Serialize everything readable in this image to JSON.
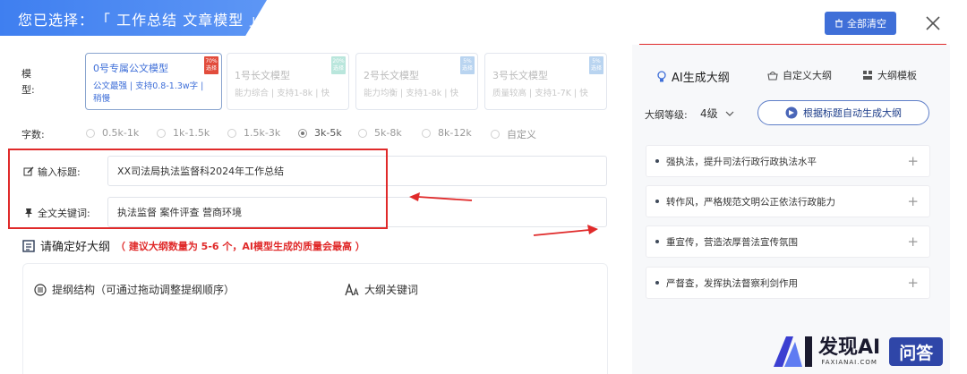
{
  "header": {
    "prefix": "您已选择：",
    "selection": "「 工作总结 文章模型 」"
  },
  "toolbar": {
    "clear_label": "全部清空"
  },
  "form": {
    "model_label": "模\n型:",
    "models": [
      {
        "name": "0号专属公文模型",
        "desc": "公文最强 | 支持0.8-1.3w字 | 稍慢",
        "badge": "70%\n选择",
        "badge_color": "#e24c3c"
      },
      {
        "name": "1号长文模型",
        "desc": "能力综合 | 支持1-8k | 快",
        "badge": "20%\n选择",
        "badge_color": "#b9e6dc"
      },
      {
        "name": "2号长文模型",
        "desc": "能力均衡 | 支持1-8k | 快",
        "badge": "5%\n选择",
        "badge_color": "#b9d4f0"
      },
      {
        "name": "3号长文模型",
        "desc": "质量较高 | 支持1-7K | 快",
        "badge": "5%\n选择",
        "badge_color": "#b9d4f0"
      }
    ],
    "wordcount_label": "字数:",
    "wordcounts": [
      "0.5k-1k",
      "1k-1.5k",
      "1.5k-3k",
      "3k-5k",
      "5k-8k",
      "8k-12k",
      "自定义"
    ],
    "wordcount_selected": "3k-5k",
    "title_label": "输入标题:",
    "title_value": "XX司法局执法监督科2024年工作总结",
    "keywords_label": "全文关键词:",
    "keywords_value": "执法监督  案件评查  营商环境"
  },
  "outline_section": {
    "title": "请确定好大纲",
    "tip": "（ 建议大纲数量为 5-6 个，AI模型生成的质量会最高 ）",
    "structure_label": "提纲结构（可通过拖动调整提纲顺序）",
    "keywords_label": "大纲关键词"
  },
  "right_panel": {
    "tabs": [
      "AI生成大纲",
      "自定义大纲",
      "大纲模板"
    ],
    "level_label": "大纲等级:",
    "level_value": "4级",
    "gen_button": "根据标题自动生成大纲",
    "items": [
      "强执法，提升司法行政行政执法水平",
      "转作风，严格规范文明公正依法行政能力",
      "重宣传，营造浓厚普法宣传氛围",
      "严督查，发挥执法督察利剑作用"
    ]
  },
  "logo": {
    "name": "发现AI",
    "domain": "FAXIANAI.COM",
    "qa": "问答"
  },
  "colors": {
    "accent": "#3f6fd8",
    "highlight": "#e02a2a",
    "active_model": "#3f6fd8"
  }
}
